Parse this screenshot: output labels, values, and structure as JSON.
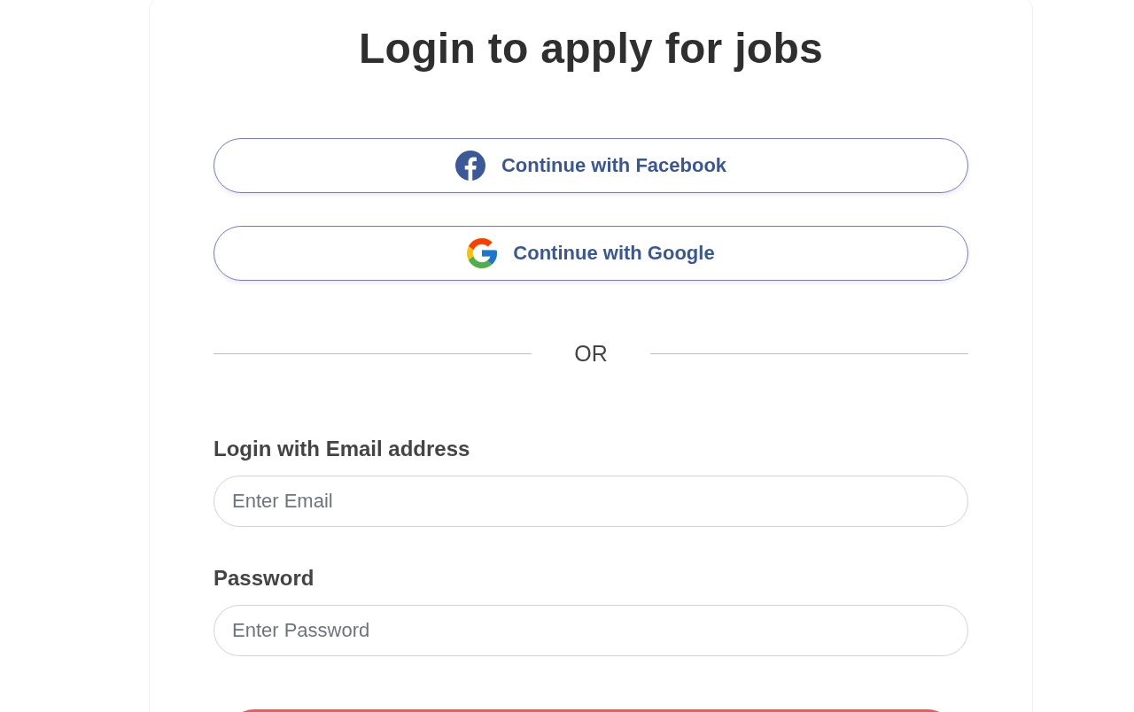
{
  "heading": "Login to apply for jobs",
  "social_buttons": [
    {
      "kind": "facebook",
      "label": "Continue with Facebook"
    },
    {
      "kind": "google",
      "label": "Continue with Google"
    }
  ],
  "divider": {
    "label": "OR"
  },
  "fields": [
    {
      "label": "Login with Email address",
      "placeholder": "Enter Email"
    },
    {
      "label": "Password",
      "placeholder": "Enter Password"
    }
  ]
}
